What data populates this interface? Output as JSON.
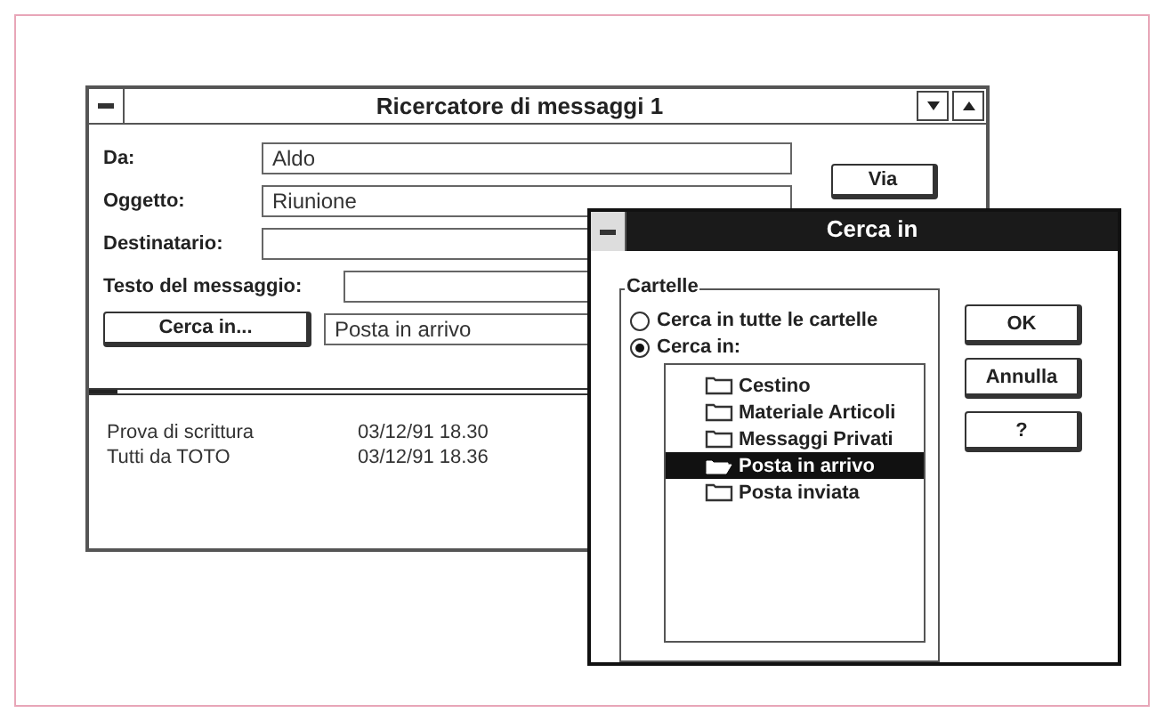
{
  "main_window": {
    "title": "Ricercatore di messaggi 1",
    "fields": [
      {
        "label": "Da:",
        "value": "Aldo"
      },
      {
        "label": "Oggetto:",
        "value": "Riunione"
      },
      {
        "label": "Destinatario:"
      },
      {
        "label": "Testo del messaggio:"
      }
    ],
    "via_button": "Via",
    "search_button": "Cerca in...",
    "search_location": "Posta in arrivo",
    "messages": [
      {
        "subject": "Prova di scrittura",
        "date": "03/12/91 18.30"
      },
      {
        "subject": "Tutti da TOTO",
        "date": "03/12/91 18.36"
      }
    ]
  },
  "dialog": {
    "title": "Cerca in",
    "group_label": "Cartelle",
    "options": [
      {
        "label": "Cerca in tutte le cartelle",
        "selected": false
      },
      {
        "label": "Cerca in:",
        "selected": true
      }
    ],
    "folders": [
      {
        "name": "Cestino",
        "selected": false
      },
      {
        "name": "Materiale Articoli",
        "selected": false
      },
      {
        "name": "Messaggi Privati",
        "selected": false
      },
      {
        "name": "Posta in arrivo",
        "selected": true
      },
      {
        "name": "Posta inviata",
        "selected": false
      }
    ],
    "buttons": [
      "OK",
      "Annulla",
      "?"
    ]
  }
}
